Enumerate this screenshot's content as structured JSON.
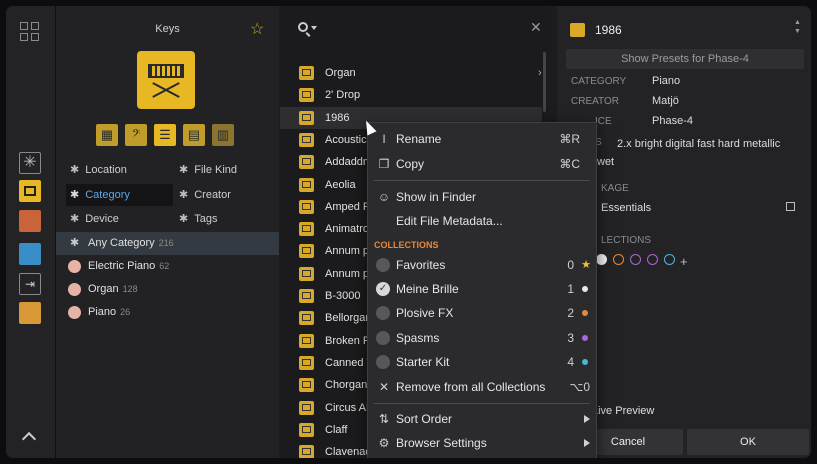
{
  "left_panel": {
    "title": "Keys",
    "filters": {
      "location": "Location",
      "file_kind": "File Kind",
      "category": "Category",
      "creator": "Creator",
      "device": "Device",
      "tags": "Tags"
    },
    "categories": [
      {
        "label": "Any Category",
        "count": "216"
      },
      {
        "label": "Electric Piano",
        "count": "62"
      },
      {
        "label": "Organ",
        "count": "128"
      },
      {
        "label": "Piano",
        "count": "26"
      }
    ]
  },
  "file_list": {
    "items": [
      "Organ",
      "2' Drop",
      "1986",
      "Acoustic I",
      "Addaddm",
      "Aeolia",
      "Amped Rh",
      "Animatron",
      "Annum pe",
      "Annum pe",
      "B-3000",
      "Bellorgan",
      "Broken Pi",
      "Canned W",
      "Chorgan C",
      "Circus AR",
      "Claff",
      "Clavenade"
    ]
  },
  "context_menu": {
    "rename": "Rename",
    "rename_shortcut": "⌘R",
    "copy": "Copy",
    "copy_shortcut": "⌘C",
    "show_in_finder": "Show in Finder",
    "edit_metadata": "Edit File Metadata...",
    "collections_header": "COLLECTIONS",
    "collections": [
      {
        "label": "Favorites",
        "num": "0",
        "color": "#f2c230"
      },
      {
        "label": "Meine Brille",
        "num": "1",
        "color": "#e8e8e8"
      },
      {
        "label": "Plosive FX",
        "num": "2",
        "color": "#e88838"
      },
      {
        "label": "Spasms",
        "num": "3",
        "color": "#a86ad8"
      },
      {
        "label": "Starter Kit",
        "num": "4",
        "color": "#48b8d8"
      }
    ],
    "remove_all": "Remove from all Collections",
    "remove_shortcut": "⌥0",
    "sort_order": "Sort Order",
    "browser_settings": "Browser Settings"
  },
  "right_panel": {
    "title": "1986",
    "show_presets": "Show Presets for Phase-4",
    "category_label": "CATEGORY",
    "category_value": "Piano",
    "creator_label": "CREATOR",
    "creator_value": "Matjö",
    "device_label_partial": "ICE",
    "device_value": "Phase-4",
    "tags_label_partial": "S",
    "tags_value": "2.x  bright  digital  fast  hard  metallic",
    "tags_value_line2": "wet",
    "package_label_partial": "KAGE",
    "package_value": "Essentials",
    "collections_label_partial": "LECTIONS",
    "live_preview_partial": "Live Preview",
    "cancel": "Cancel",
    "ok": "OK"
  },
  "colors": {
    "accent_yellow": "#e7b824",
    "selected_blue": "#5aa8e8",
    "collections_orange": "#e88838"
  }
}
